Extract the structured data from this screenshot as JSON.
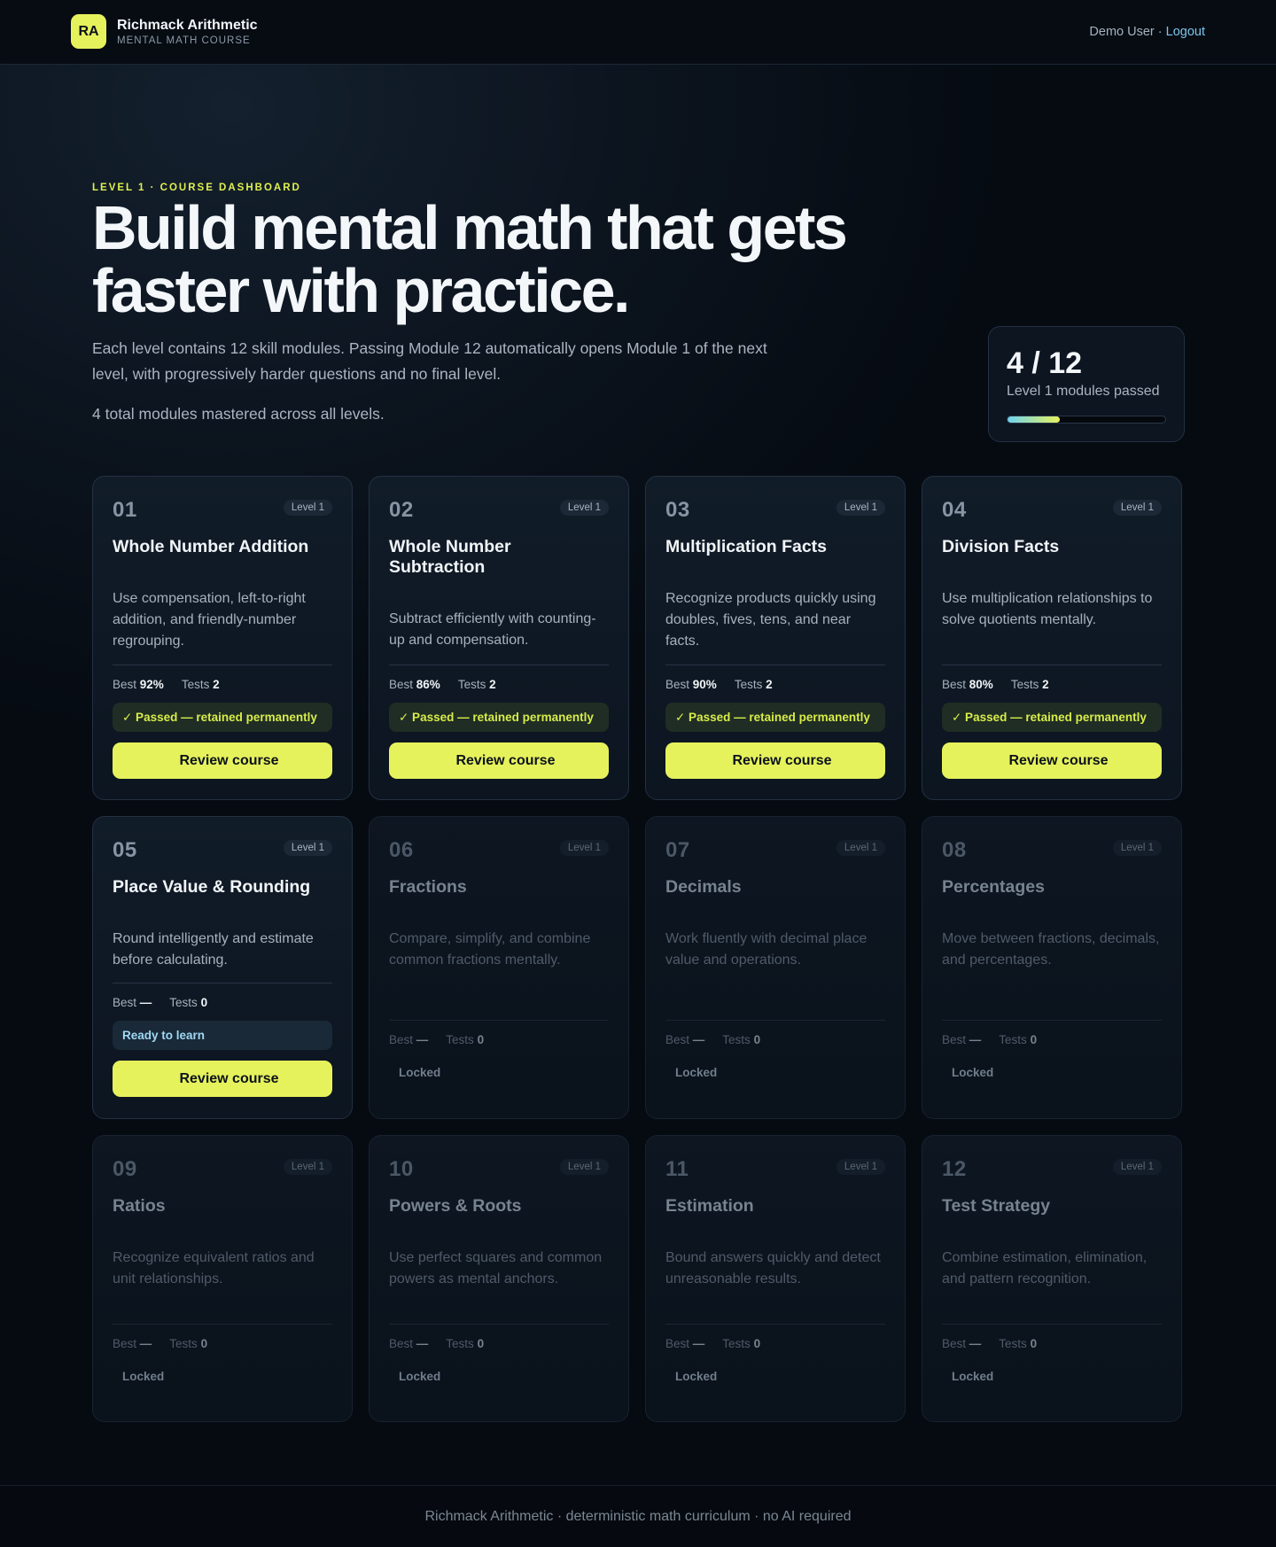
{
  "header": {
    "logo_initials": "RA",
    "brand_name": "Richmack Arithmetic",
    "brand_sub": "MENTAL MATH COURSE",
    "user_name": "Demo User",
    "separator": " · ",
    "logout_label": "Logout"
  },
  "hero": {
    "eyebrow": "LEVEL 1 · COURSE DASHBOARD",
    "title_line1": "Build mental math that gets",
    "title_line2": "faster with practice.",
    "description": "Each level contains 12 skill modules. Passing Module 12 automatically opens Module 1 of the next level, with progressively harder questions and no final level.",
    "total_mastered": "4 total modules mastered across all levels."
  },
  "progress": {
    "value": "4 / 12",
    "label": "Level 1 modules passed",
    "fraction": 0.333
  },
  "labels": {
    "best": "Best",
    "tests": "Tests",
    "level_pill": "Level 1",
    "passed_status": "✓ Passed — retained permanently",
    "ready_status": "Ready to learn",
    "review_button": "Review course",
    "locked": "Locked"
  },
  "modules": [
    {
      "num": "01",
      "title": "Whole Number Addition",
      "desc": "Use compensation, left-to-right addition, and friendly-number regrouping.",
      "best": "92%",
      "tests": "2",
      "state": "passed"
    },
    {
      "num": "02",
      "title": "Whole Number Subtraction",
      "desc": "Subtract efficiently with counting-up and compensation.",
      "best": "86%",
      "tests": "2",
      "state": "passed"
    },
    {
      "num": "03",
      "title": "Multiplication Facts",
      "desc": "Recognize products quickly using doubles, fives, tens, and near facts.",
      "best": "90%",
      "tests": "2",
      "state": "passed"
    },
    {
      "num": "04",
      "title": "Division Facts",
      "desc": "Use multiplication relationships to solve quotients mentally.",
      "best": "80%",
      "tests": "2",
      "state": "passed"
    },
    {
      "num": "05",
      "title": "Place Value & Rounding",
      "desc": "Round intelligently and estimate before calculating.",
      "best": "—",
      "tests": "0",
      "state": "ready"
    },
    {
      "num": "06",
      "title": "Fractions",
      "desc": "Compare, simplify, and combine common fractions mentally.",
      "best": "—",
      "tests": "0",
      "state": "locked"
    },
    {
      "num": "07",
      "title": "Decimals",
      "desc": "Work fluently with decimal place value and operations.",
      "best": "—",
      "tests": "0",
      "state": "locked"
    },
    {
      "num": "08",
      "title": "Percentages",
      "desc": "Move between fractions, decimals, and percentages.",
      "best": "—",
      "tests": "0",
      "state": "locked"
    },
    {
      "num": "09",
      "title": "Ratios",
      "desc": "Recognize equivalent ratios and unit relationships.",
      "best": "—",
      "tests": "0",
      "state": "locked"
    },
    {
      "num": "10",
      "title": "Powers & Roots",
      "desc": "Use perfect squares and common powers as mental anchors.",
      "best": "—",
      "tests": "0",
      "state": "locked"
    },
    {
      "num": "11",
      "title": "Estimation",
      "desc": "Bound answers quickly and detect unreasonable results.",
      "best": "—",
      "tests": "0",
      "state": "locked"
    },
    {
      "num": "12",
      "title": "Test Strategy",
      "desc": "Combine estimation, elimination, and pattern recognition.",
      "best": "—",
      "tests": "0",
      "state": "locked"
    }
  ],
  "footer": {
    "text": "Richmack Arithmetic · deterministic math curriculum · no AI required"
  },
  "colors": {
    "accent": "#e6f25c",
    "link": "#7cc4ea",
    "background": "#060b12"
  }
}
